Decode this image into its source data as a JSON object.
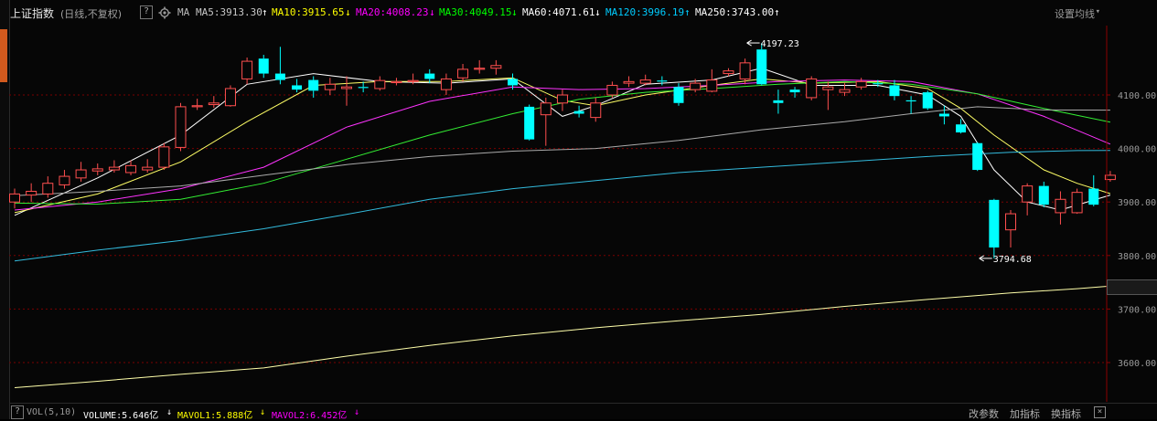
{
  "header": {
    "title": "上证指数",
    "subtitle": "(日线,不复权)",
    "help": "?",
    "ma_label": "MA",
    "ma_items": [
      {
        "text": "MA5:3913.30",
        "arrow": "↑",
        "color": "#ffffff"
      },
      {
        "text": "MA10:3915.65",
        "arrow": "↓",
        "color": "#ffff00"
      },
      {
        "text": "MA20:4008.23",
        "arrow": "↓",
        "color": "#ff00ff"
      },
      {
        "text": "MA30:4049.15",
        "arrow": "↓",
        "color": "#00ff00"
      },
      {
        "text": "MA60:4071.61",
        "arrow": "↓",
        "color": "#ffffff"
      },
      {
        "text": "MA120:3996.19",
        "arrow": "↑",
        "color": "#00ccff"
      },
      {
        "text": "MA250:3743.00",
        "arrow": "↑",
        "color": "#ffffff"
      }
    ],
    "settings": "设置均线",
    "settings_arrow": "▾"
  },
  "footer": {
    "help": "?",
    "vol_label": "VOL(5,10)",
    "items": [
      {
        "text": "VOLUME:5.646亿",
        "arrow": "↓",
        "color": "#ffffff"
      },
      {
        "text": "MAVOL1:5.888亿",
        "arrow": "↓",
        "color": "#ffff00"
      },
      {
        "text": "MAVOL2:6.452亿",
        "arrow": "↓",
        "color": "#ff00ff"
      }
    ],
    "buttons": [
      "改参数",
      "加指标",
      "换指标"
    ],
    "close": "×"
  },
  "colors": {
    "up": "#ff4f4f",
    "down": "#00ffff",
    "grid": "#7a0000",
    "ma5": "#ffffff",
    "ma10": "#ffff66",
    "ma20": "#ff33ff",
    "ma30": "#33ee33",
    "ma60": "#aaaaaa",
    "ma120": "#33bbdd",
    "ma250": "#ffffaa"
  },
  "chart_data": {
    "type": "candlestick",
    "y_ticks": [
      "4100.00",
      "4000.00",
      "3900.00",
      "3800.00",
      "3700.00",
      "3600.00"
    ],
    "y_tick_values": [
      4100,
      4000,
      3900,
      3800,
      3700,
      3600
    ],
    "ylim": [
      3550,
      4235
    ],
    "current_price_label": "3728.06",
    "high_annotation": {
      "text": "4197.23",
      "value": 4197.23,
      "index": 44
    },
    "low_annotation": {
      "text": "3794.68",
      "value": 3794.68,
      "index": 58
    },
    "candles": [
      [
        3900,
        3915,
        3925,
        3888
      ],
      [
        3913,
        3920,
        3935,
        3900
      ],
      [
        3915,
        3935,
        3948,
        3908
      ],
      [
        3932,
        3948,
        3960,
        3925
      ],
      [
        3945,
        3960,
        3975,
        3938
      ],
      [
        3958,
        3962,
        3972,
        3950
      ],
      [
        3960,
        3965,
        3978,
        3955
      ],
      [
        3955,
        3968,
        3978,
        3950
      ],
      [
        3960,
        3965,
        3980,
        3955
      ],
      [
        3965,
        4003,
        4010,
        3960
      ],
      [
        4002,
        4078,
        4085,
        3995
      ],
      [
        4078,
        4080,
        4093,
        4072
      ],
      [
        4082,
        4085,
        4098,
        4076
      ],
      [
        4080,
        4112,
        4118,
        4078
      ],
      [
        4130,
        4163,
        4170,
        4120
      ],
      [
        4168,
        4140,
        4175,
        4132
      ],
      [
        4140,
        4128,
        4190,
        4120
      ],
      [
        4118,
        4110,
        4130,
        4105
      ],
      [
        4128,
        4108,
        4135,
        4095
      ],
      [
        4110,
        4120,
        4132,
        4100
      ],
      [
        4112,
        4115,
        4135,
        4080
      ],
      [
        4115,
        4113,
        4125,
        4105
      ],
      [
        4112,
        4127,
        4135,
        4108
      ],
      [
        4123,
        4125,
        4132,
        4118
      ],
      [
        4125,
        4127,
        4140,
        4120
      ],
      [
        4140,
        4130,
        4148,
        4122
      ],
      [
        4110,
        4130,
        4140,
        4100
      ],
      [
        4132,
        4148,
        4158,
        4125
      ],
      [
        4148,
        4150,
        4165,
        4140
      ],
      [
        4150,
        4155,
        4165,
        4138
      ],
      [
        4130,
        4118,
        4140,
        4110
      ],
      [
        4078,
        4017,
        4082,
        4015
      ],
      [
        4063,
        4085,
        4095,
        4005
      ],
      [
        4085,
        4100,
        4110,
        4070
      ],
      [
        4070,
        4065,
        4080,
        4058
      ],
      [
        4058,
        4085,
        4095,
        4050
      ],
      [
        4100,
        4118,
        4125,
        4095
      ],
      [
        4122,
        4125,
        4135,
        4115
      ],
      [
        4122,
        4128,
        4138,
        4118
      ],
      [
        4127,
        4125,
        4135,
        4118
      ],
      [
        4115,
        4085,
        4122,
        4080
      ],
      [
        4110,
        4122,
        4130,
        4105
      ],
      [
        4107,
        4128,
        4148,
        4105
      ],
      [
        4140,
        4145,
        4150,
        4135
      ],
      [
        4130,
        4160,
        4168,
        4120
      ],
      [
        4185,
        4120,
        4197.23,
        4118
      ],
      [
        4090,
        4085,
        4110,
        4065
      ],
      [
        4110,
        4105,
        4115,
        4095
      ],
      [
        4095,
        4130,
        4135,
        4090
      ],
      [
        4110,
        4115,
        4125,
        4072
      ],
      [
        4105,
        4110,
        4122,
        4098
      ],
      [
        4115,
        4125,
        4132,
        4110
      ],
      [
        4122,
        4120,
        4128,
        4115
      ],
      [
        4118,
        4098,
        4128,
        4090
      ],
      [
        4090,
        4088,
        4098,
        4065
      ],
      [
        4105,
        4075,
        4108,
        4072
      ],
      [
        4065,
        4060,
        4080,
        4045
      ],
      [
        4045,
        4030,
        4055,
        4028
      ],
      [
        4010,
        3960,
        4012,
        3958
      ],
      [
        3904,
        3815,
        3906,
        3794.68
      ],
      [
        3848,
        3878,
        3885,
        3815
      ],
      [
        3900,
        3930,
        3935,
        3875
      ],
      [
        3930,
        3895,
        3938,
        3890
      ],
      [
        3880,
        3905,
        3920,
        3858
      ],
      [
        3880,
        3918,
        3925,
        3878
      ],
      [
        3925,
        3895,
        3950,
        3892
      ],
      [
        3942,
        3950,
        3958,
        3938
      ]
    ],
    "ma_series": [
      {
        "name": "MA5",
        "color_key": "ma5",
        "pts": [
          [
            0,
            3875
          ],
          [
            5,
            3945
          ],
          [
            10,
            4025
          ],
          [
            14,
            4120
          ],
          [
            18,
            4140
          ],
          [
            22,
            4125
          ],
          [
            26,
            4122
          ],
          [
            30,
            4130
          ],
          [
            33,
            4060
          ],
          [
            35,
            4080
          ],
          [
            38,
            4120
          ],
          [
            42,
            4128
          ],
          [
            45,
            4150
          ],
          [
            48,
            4118
          ],
          [
            52,
            4118
          ],
          [
            55,
            4100
          ],
          [
            57,
            4060
          ],
          [
            59,
            3960
          ],
          [
            61,
            3900
          ],
          [
            63,
            3885
          ],
          [
            66,
            3913
          ]
        ]
      },
      {
        "name": "MA10",
        "color_key": "ma10",
        "pts": [
          [
            0,
            3880
          ],
          [
            5,
            3915
          ],
          [
            10,
            3975
          ],
          [
            14,
            4050
          ],
          [
            18,
            4118
          ],
          [
            22,
            4125
          ],
          [
            26,
            4125
          ],
          [
            30,
            4132
          ],
          [
            33,
            4090
          ],
          [
            35,
            4080
          ],
          [
            38,
            4100
          ],
          [
            42,
            4118
          ],
          [
            45,
            4130
          ],
          [
            48,
            4122
          ],
          [
            52,
            4125
          ],
          [
            55,
            4112
          ],
          [
            57,
            4075
          ],
          [
            59,
            4025
          ],
          [
            62,
            3960
          ],
          [
            64,
            3935
          ],
          [
            66,
            3915.65
          ]
        ]
      },
      {
        "name": "MA20",
        "color_key": "ma20",
        "pts": [
          [
            0,
            3885
          ],
          [
            5,
            3900
          ],
          [
            10,
            3925
          ],
          [
            15,
            3965
          ],
          [
            20,
            4040
          ],
          [
            25,
            4088
          ],
          [
            30,
            4115
          ],
          [
            34,
            4110
          ],
          [
            38,
            4112
          ],
          [
            42,
            4118
          ],
          [
            46,
            4125
          ],
          [
            50,
            4128
          ],
          [
            54,
            4125
          ],
          [
            58,
            4102
          ],
          [
            62,
            4060
          ],
          [
            66,
            4008.23
          ]
        ]
      },
      {
        "name": "MA30",
        "color_key": "ma30",
        "pts": [
          [
            0,
            3898
          ],
          [
            5,
            3896
          ],
          [
            10,
            3905
          ],
          [
            15,
            3935
          ],
          [
            20,
            3980
          ],
          [
            25,
            4025
          ],
          [
            30,
            4065
          ],
          [
            34,
            4092
          ],
          [
            38,
            4105
          ],
          [
            42,
            4112
          ],
          [
            46,
            4120
          ],
          [
            50,
            4125
          ],
          [
            54,
            4120
          ],
          [
            58,
            4102
          ],
          [
            62,
            4075
          ],
          [
            66,
            4049.15
          ]
        ]
      },
      {
        "name": "MA60",
        "color_key": "ma60",
        "pts": [
          [
            0,
            3912
          ],
          [
            5,
            3920
          ],
          [
            10,
            3930
          ],
          [
            15,
            3950
          ],
          [
            20,
            3970
          ],
          [
            25,
            3985
          ],
          [
            30,
            3995
          ],
          [
            35,
            4000
          ],
          [
            40,
            4015
          ],
          [
            45,
            4035
          ],
          [
            50,
            4050
          ],
          [
            54,
            4065
          ],
          [
            58,
            4078
          ],
          [
            62,
            4072
          ],
          [
            66,
            4071.61
          ]
        ]
      },
      {
        "name": "MA120",
        "color_key": "ma120",
        "pts": [
          [
            0,
            3790
          ],
          [
            5,
            3810
          ],
          [
            10,
            3828
          ],
          [
            15,
            3850
          ],
          [
            20,
            3877
          ],
          [
            25,
            3905
          ],
          [
            30,
            3925
          ],
          [
            35,
            3940
          ],
          [
            40,
            3955
          ],
          [
            45,
            3965
          ],
          [
            50,
            3975
          ],
          [
            55,
            3985
          ],
          [
            60,
            3993
          ],
          [
            64,
            3996
          ],
          [
            66,
            3996.19
          ]
        ]
      },
      {
        "name": "MA250",
        "color_key": "ma250",
        "pts": [
          [
            0,
            3553
          ],
          [
            5,
            3565
          ],
          [
            10,
            3578
          ],
          [
            15,
            3590
          ],
          [
            20,
            3612
          ],
          [
            25,
            3632
          ],
          [
            30,
            3650
          ],
          [
            35,
            3665
          ],
          [
            40,
            3678
          ],
          [
            45,
            3690
          ],
          [
            50,
            3705
          ],
          [
            55,
            3718
          ],
          [
            60,
            3730
          ],
          [
            64,
            3738
          ],
          [
            66,
            3743.0
          ]
        ]
      }
    ]
  }
}
